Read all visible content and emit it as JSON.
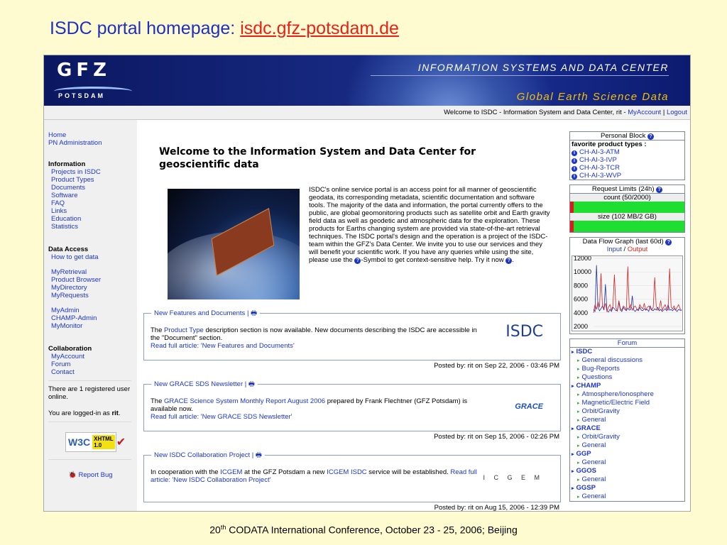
{
  "slide": {
    "title_prefix": "ISDC portal homepage: ",
    "title_url": "isdc.gfz-potsdam.de",
    "footer_num": "20",
    "footer_sup": "th",
    "footer_rest": " CODATA International Conference, October 23 - 25, 2006; Beijing"
  },
  "banner": {
    "logo_text": "GFZ",
    "logo_sub": "Potsdam",
    "center_name": "INFORMATION SYSTEMS AND DATA CENTER",
    "tagline": "Global Earth Science Data"
  },
  "welcome": {
    "prefix": "Welcome to ISDC - Information System and Data Center, rit - ",
    "my_account": "MyAccount",
    "separator": " | ",
    "logout": "Logout"
  },
  "sidebar": {
    "home": "Home",
    "pn_admin": "PN Administration",
    "info_head": "Information",
    "info_items": [
      "Projects in ISDC",
      "Product Types",
      "Documents",
      "Software",
      "FAQ",
      "Links",
      "Education",
      "Statistics"
    ],
    "data_head": "Data Access",
    "how_to": "How to get data",
    "my_items": [
      "MyRetrieval",
      "Product Browser",
      "MyDirectory",
      "MyRequests"
    ],
    "admin_items": [
      "MyAdmin",
      "CHAMP-Admin",
      "MyMonitor"
    ],
    "collab_head": "Collaboration",
    "collab_items": [
      "MyAccount",
      "Forum",
      "Contact"
    ],
    "online_text": "There are 1 registered user online.",
    "logged_prefix": "You are logged-in as ",
    "logged_user": "rit",
    "logged_suffix": ".",
    "w3c_w": "W3C",
    "w3c_xhtml": "XHTML",
    "w3c_ver": "1.0",
    "report_bug": "Report Bug"
  },
  "main": {
    "heading": "Welcome to the Information System and Data Center for geoscientific data",
    "intro_1": "ISDC's online service portal is an access point for all manner of geoscientific geodata, its corresponding metadata, scientific documentation and software tools. The majority of the data and information, the portal currently offers to the public, are global geomonitoring products such as satellite orbit and Earth gravity field data as well as geodetic and atmospheric data for the exploration. These products for Earths changing system are provided via state-of-the-art retrieval techniques. The ISDC portal's design and the operation is a project of the ISDC-team within the GFZ's Data Center. We invite you to use our services and they will benefit your scientific work. If you have any queries while using the site, please use the ",
    "intro_2": "-Symbol to get context-sensitive help. Try it now ",
    "intro_3": "."
  },
  "news": [
    {
      "title": "New Features and Documents | ",
      "b1": "The ",
      "b_link": "Product Type",
      "b2": " description section is now available. New documents describing the ISDC are accessible in the \"Document\" section.",
      "read": "Read full article: 'New Features and Documents'",
      "posted": "Posted by: rit on Sep 22, 2006 - 03:46 PM",
      "logo": "ISDC"
    },
    {
      "title": "New GRACE SDS Newsletter | ",
      "b1": "The ",
      "b_link": "GRACE Science System Monthly Report August 2006",
      "b2": " prepared by Frank Flechtner (GFZ Potsdam) is available now.",
      "read": "Read full article: 'New GRACE SDS Newsletter'",
      "posted": "Posted by: rit on Sep 15, 2006 - 02:26 PM",
      "logo": "GRACE"
    },
    {
      "title": "New ISDC Collaboration Project | ",
      "b1": "In cooperation with the ",
      "b_link": "ICGEM",
      "b2": " at the GFZ Potsdam a new ",
      "b_link2": "ICGEM ISDC",
      "b3": " service will be established. ",
      "read": "Read full article: 'New ISDC Collaboration Project'",
      "posted": "Posted by: rit on Aug 15, 2006 - 12:39 PM",
      "logo": "I C G E M"
    }
  ],
  "right": {
    "personal_head": "Personal Block ",
    "fav_head": "favorite product types :",
    "fav_items": [
      "CH-AI-3-ATM",
      "CH-AI-3-IVP",
      "CH-AI-3-TCR",
      "CH-AI-3-WVP"
    ],
    "req_head": "Request Limits (24h) ",
    "count_label": "count (50/2000)",
    "size_label": "size (102 MB/2 GB)",
    "flow_head": "Data Flow Graph (last 60d) ",
    "flow_input": "Input",
    "flow_sep": " / ",
    "flow_output": "Output",
    "forum_head": "Forum",
    "forum": [
      {
        "name": "ISDC",
        "items": [
          "General discussions",
          "Bug-Reports",
          "Questions"
        ]
      },
      {
        "name": "CHAMP",
        "items": [
          "Atmosphere/Ionosphere",
          "Magnetic/Electric Field",
          "Orbit/Gravity",
          "General"
        ]
      },
      {
        "name": "GRACE",
        "items": [
          "Orbit/Gravity",
          "General"
        ]
      },
      {
        "name": "GGP",
        "items": [
          "General"
        ]
      },
      {
        "name": "GGOS",
        "items": [
          "General"
        ]
      },
      {
        "name": "GGSP",
        "items": [
          "General"
        ]
      }
    ]
  },
  "chart_data": {
    "type": "line",
    "title": "",
    "ylim": [
      2000,
      12000
    ],
    "yticks": [
      12000,
      10000,
      8000,
      6000,
      4000,
      2000
    ],
    "series": [
      {
        "name": "Input",
        "color": "#1d2fa8",
        "values": [
          4500,
          4200,
          11000,
          4800,
          4300,
          4600,
          5000,
          4400,
          8200,
          4300,
          4100,
          4500,
          4200,
          4800,
          4600,
          4300,
          4400,
          5500,
          4400,
          4200,
          4800,
          4500,
          4300,
          4700,
          4400,
          4500,
          6500,
          4400,
          4200,
          4500,
          4300,
          4800,
          4400,
          4300,
          4600,
          4400,
          4500,
          4200,
          5000,
          4400,
          4300,
          4600,
          4400,
          4800,
          4300,
          4500,
          4200,
          4400,
          4600,
          4300,
          5200,
          4400,
          4500,
          4300,
          4600,
          4400,
          4200,
          4500,
          4400,
          4300
        ]
      },
      {
        "name": "Output",
        "color": "#d42020",
        "values": [
          4000,
          5200,
          4500,
          5600,
          4800,
          9800,
          5000,
          4600,
          5400,
          4200,
          4800,
          5200,
          4400,
          5000,
          9600,
          4800,
          4200,
          5800,
          4600,
          4400,
          5000,
          4800,
          4400,
          10800,
          4600,
          5200,
          4400,
          4800,
          5000,
          4600,
          4400,
          5200,
          4800,
          4600,
          5400,
          4400,
          4800,
          5000,
          4600,
          4400,
          4800,
          9200,
          5000,
          4400,
          4600,
          5800,
          4400,
          4800,
          5200,
          4600,
          4400,
          10500,
          4800,
          4600,
          5000,
          4400,
          4800,
          5200,
          4600,
          4400
        ]
      }
    ]
  }
}
